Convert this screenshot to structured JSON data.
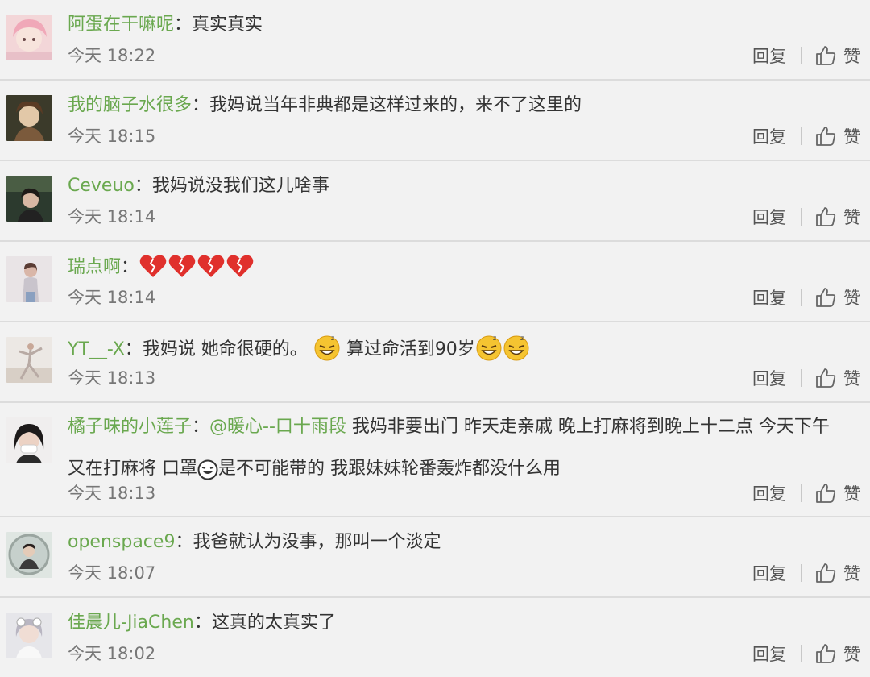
{
  "comments": [
    {
      "user": "阿蛋在干嘛呢",
      "colon": "：",
      "text": "真实真实",
      "time": "今天 18:22",
      "reply": "回复",
      "like": "赞"
    },
    {
      "user": "我的脑子水很多",
      "colon": "：",
      "text": "我妈说当年非典都是这样过来的，来不了这里的",
      "time": "今天 18:15",
      "reply": "回复",
      "like": "赞"
    },
    {
      "user": "Ceveuo",
      "colon": "：",
      "text": "我妈说没我们这儿啥事",
      "time": "今天 18:14",
      "reply": "回复",
      "like": "赞"
    },
    {
      "user": "瑞点啊",
      "colon": "：",
      "emojis": [
        "broken-heart-icon",
        "broken-heart-icon",
        "broken-heart-icon",
        "broken-heart-icon"
      ],
      "time": "今天 18:14",
      "reply": "回复",
      "like": "赞"
    },
    {
      "user": "YT__-X",
      "colon": "：",
      "text": "我妈说 她命很硬的。",
      "text2": "算过命活到90岁",
      "emoji_names": [
        "sleepy-grin-emoji-icon"
      ],
      "time": "今天 18:13",
      "reply": "回复",
      "like": "赞"
    },
    {
      "user": "橘子味的小莲子",
      "colon": "：",
      "mention": "@暖心--口十雨段",
      "text": "我妈非要出门 昨天走亲戚 晚上打麻将到晚上十二点 今天下午",
      "text_line2a": "又在打麻将 口罩",
      "text_line2b": "是不可能带的 我跟妹妹轮番轰炸都没什么用",
      "time": "今天 18:13",
      "reply": "回复",
      "like": "赞"
    },
    {
      "user": "openspace9",
      "colon": "：",
      "text": "我爸就认为没事，那叫一个淡定",
      "time": "今天 18:07",
      "reply": "回复",
      "like": "赞"
    },
    {
      "user": "佳晨儿-JiaChen",
      "colon": "：",
      "text": "这真的太真实了",
      "time": "今天 18:02",
      "reply": "回复",
      "like": "赞"
    }
  ],
  "colors": {
    "username": "#6aa84f",
    "text": "#333333",
    "meta": "#777777",
    "background": "#f2f2f2",
    "separator": "#dcdcdc"
  }
}
